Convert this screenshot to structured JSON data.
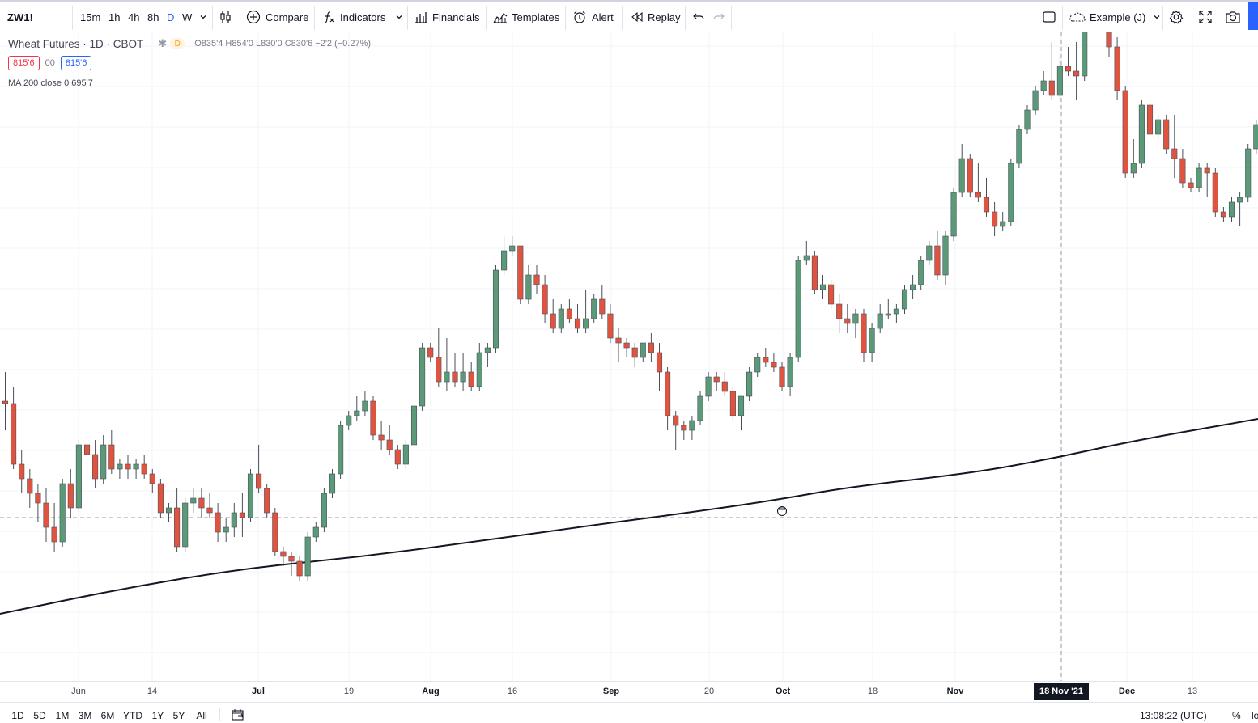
{
  "toolbar": {
    "symbol": "ZW1!",
    "timeframes": [
      "15m",
      "1h",
      "4h",
      "8h",
      "D",
      "W"
    ],
    "active_timeframe": "D",
    "compare_label": "Compare",
    "indicators_label": "Indicators",
    "financials_label": "Financials",
    "templates_label": "Templates",
    "alert_label": "Alert",
    "replay_label": "Replay",
    "layout_label": "Example (J)"
  },
  "legend": {
    "title": "Wheat Futures · 1D · CBOT",
    "status": "D",
    "ohlc": "O835'4  H854'0  L830'0  C830'6  −2'2 (−0.27%)",
    "bid": "815'6",
    "spread": "00",
    "ask": "815'6",
    "ma": "MA 200 close 0  695'7"
  },
  "colors": {
    "up": "#5b9a78",
    "down": "#e0543f",
    "ma_line": "#131722",
    "accent": "#2962ff"
  },
  "chart_data": {
    "type": "candlestick",
    "symbol": "Wheat Futures",
    "interval": "1D",
    "exchange": "CBOT",
    "x_tick_labels": [
      "Jun",
      "14",
      "Jul",
      "19",
      "Aug",
      "16",
      "Sep",
      "20",
      "Oct",
      "18",
      "Nov",
      "18 Nov '21",
      "Dec",
      "13"
    ],
    "crosshair_label": "18 Nov '21",
    "candles_ohlc_rel": [
      [
        0.44,
        0.5,
        0.38,
        0.435
      ],
      [
        0.435,
        0.47,
        0.3,
        0.31
      ],
      [
        0.31,
        0.34,
        0.25,
        0.28
      ],
      [
        0.28,
        0.3,
        0.22,
        0.25
      ],
      [
        0.25,
        0.27,
        0.19,
        0.23
      ],
      [
        0.23,
        0.26,
        0.15,
        0.18
      ],
      [
        0.18,
        0.23,
        0.13,
        0.15
      ],
      [
        0.15,
        0.28,
        0.14,
        0.27
      ],
      [
        0.27,
        0.3,
        0.2,
        0.22
      ],
      [
        0.22,
        0.36,
        0.21,
        0.35
      ],
      [
        0.35,
        0.38,
        0.3,
        0.33
      ],
      [
        0.33,
        0.36,
        0.26,
        0.28
      ],
      [
        0.28,
        0.37,
        0.27,
        0.35
      ],
      [
        0.35,
        0.38,
        0.29,
        0.3
      ],
      [
        0.3,
        0.32,
        0.28,
        0.31
      ],
      [
        0.31,
        0.33,
        0.28,
        0.3
      ],
      [
        0.3,
        0.32,
        0.28,
        0.31
      ],
      [
        0.31,
        0.33,
        0.28,
        0.29
      ],
      [
        0.29,
        0.3,
        0.25,
        0.27
      ],
      [
        0.27,
        0.28,
        0.2,
        0.21
      ],
      [
        0.21,
        0.23,
        0.19,
        0.22
      ],
      [
        0.22,
        0.26,
        0.13,
        0.14
      ],
      [
        0.14,
        0.24,
        0.13,
        0.23
      ],
      [
        0.23,
        0.26,
        0.21,
        0.24
      ],
      [
        0.24,
        0.26,
        0.2,
        0.22
      ],
      [
        0.22,
        0.25,
        0.2,
        0.21
      ],
      [
        0.21,
        0.23,
        0.15,
        0.17
      ],
      [
        0.17,
        0.2,
        0.15,
        0.18
      ],
      [
        0.18,
        0.23,
        0.16,
        0.21
      ],
      [
        0.21,
        0.25,
        0.16,
        0.2
      ],
      [
        0.2,
        0.3,
        0.19,
        0.29
      ],
      [
        0.29,
        0.35,
        0.25,
        0.26
      ],
      [
        0.26,
        0.27,
        0.2,
        0.21
      ],
      [
        0.21,
        0.22,
        0.12,
        0.13
      ],
      [
        0.13,
        0.14,
        0.1,
        0.12
      ],
      [
        0.12,
        0.13,
        0.08,
        0.11
      ],
      [
        0.11,
        0.12,
        0.07,
        0.08
      ],
      [
        0.08,
        0.17,
        0.07,
        0.16
      ],
      [
        0.16,
        0.19,
        0.15,
        0.18
      ],
      [
        0.18,
        0.26,
        0.17,
        0.25
      ],
      [
        0.25,
        0.3,
        0.24,
        0.29
      ],
      [
        0.29,
        0.4,
        0.28,
        0.39
      ],
      [
        0.39,
        0.42,
        0.38,
        0.41
      ],
      [
        0.41,
        0.45,
        0.4,
        0.42
      ],
      [
        0.42,
        0.46,
        0.41,
        0.44
      ],
      [
        0.44,
        0.45,
        0.36,
        0.37
      ],
      [
        0.37,
        0.4,
        0.34,
        0.36
      ],
      [
        0.36,
        0.39,
        0.33,
        0.34
      ],
      [
        0.34,
        0.35,
        0.3,
        0.31
      ],
      [
        0.31,
        0.36,
        0.3,
        0.35
      ],
      [
        0.35,
        0.44,
        0.34,
        0.43
      ],
      [
        0.43,
        0.56,
        0.42,
        0.55
      ],
      [
        0.55,
        0.56,
        0.52,
        0.53
      ],
      [
        0.53,
        0.59,
        0.47,
        0.48
      ],
      [
        0.48,
        0.57,
        0.46,
        0.5
      ],
      [
        0.5,
        0.54,
        0.47,
        0.48
      ],
      [
        0.48,
        0.54,
        0.46,
        0.5
      ],
      [
        0.5,
        0.52,
        0.46,
        0.47
      ],
      [
        0.47,
        0.56,
        0.46,
        0.54
      ],
      [
        0.54,
        0.56,
        0.51,
        0.55
      ],
      [
        0.55,
        0.72,
        0.54,
        0.71
      ],
      [
        0.71,
        0.78,
        0.7,
        0.75
      ],
      [
        0.75,
        0.78,
        0.74,
        0.76
      ],
      [
        0.76,
        0.76,
        0.64,
        0.65
      ],
      [
        0.65,
        0.72,
        0.64,
        0.7
      ],
      [
        0.7,
        0.72,
        0.66,
        0.68
      ],
      [
        0.68,
        0.7,
        0.6,
        0.62
      ],
      [
        0.62,
        0.65,
        0.58,
        0.59
      ],
      [
        0.59,
        0.64,
        0.58,
        0.63
      ],
      [
        0.63,
        0.65,
        0.6,
        0.61
      ],
      [
        0.61,
        0.64,
        0.58,
        0.59
      ],
      [
        0.59,
        0.67,
        0.58,
        0.61
      ],
      [
        0.61,
        0.66,
        0.6,
        0.65
      ],
      [
        0.65,
        0.68,
        0.61,
        0.62
      ],
      [
        0.62,
        0.64,
        0.56,
        0.57
      ],
      [
        0.57,
        0.59,
        0.52,
        0.56
      ],
      [
        0.56,
        0.57,
        0.53,
        0.55
      ],
      [
        0.55,
        0.56,
        0.51,
        0.53
      ],
      [
        0.53,
        0.56,
        0.52,
        0.56
      ],
      [
        0.56,
        0.58,
        0.52,
        0.54
      ],
      [
        0.54,
        0.56,
        0.46,
        0.5
      ],
      [
        0.5,
        0.51,
        0.38,
        0.41
      ],
      [
        0.41,
        0.42,
        0.34,
        0.39
      ],
      [
        0.39,
        0.4,
        0.36,
        0.38
      ],
      [
        0.38,
        0.41,
        0.36,
        0.4
      ],
      [
        0.4,
        0.46,
        0.39,
        0.45
      ],
      [
        0.45,
        0.5,
        0.44,
        0.49
      ],
      [
        0.49,
        0.5,
        0.46,
        0.48
      ],
      [
        0.48,
        0.5,
        0.45,
        0.46
      ],
      [
        0.46,
        0.47,
        0.4,
        0.41
      ],
      [
        0.41,
        0.45,
        0.38,
        0.45
      ],
      [
        0.45,
        0.51,
        0.44,
        0.5
      ],
      [
        0.5,
        0.54,
        0.49,
        0.53
      ],
      [
        0.53,
        0.55,
        0.51,
        0.52
      ],
      [
        0.52,
        0.54,
        0.5,
        0.51
      ],
      [
        0.51,
        0.52,
        0.46,
        0.47
      ],
      [
        0.47,
        0.54,
        0.45,
        0.53
      ],
      [
        0.53,
        0.74,
        0.52,
        0.73
      ],
      [
        0.73,
        0.77,
        0.72,
        0.74
      ],
      [
        0.74,
        0.75,
        0.66,
        0.67
      ],
      [
        0.67,
        0.7,
        0.65,
        0.68
      ],
      [
        0.68,
        0.69,
        0.63,
        0.64
      ],
      [
        0.64,
        0.66,
        0.58,
        0.61
      ],
      [
        0.61,
        0.64,
        0.58,
        0.6
      ],
      [
        0.6,
        0.63,
        0.57,
        0.62
      ],
      [
        0.62,
        0.63,
        0.52,
        0.54
      ],
      [
        0.54,
        0.6,
        0.52,
        0.59
      ],
      [
        0.59,
        0.64,
        0.58,
        0.62
      ],
      [
        0.62,
        0.65,
        0.61,
        0.62
      ],
      [
        0.62,
        0.64,
        0.6,
        0.63
      ],
      [
        0.63,
        0.68,
        0.62,
        0.67
      ],
      [
        0.67,
        0.7,
        0.65,
        0.68
      ],
      [
        0.68,
        0.74,
        0.67,
        0.73
      ],
      [
        0.73,
        0.77,
        0.72,
        0.76
      ],
      [
        0.76,
        0.79,
        0.69,
        0.7
      ],
      [
        0.7,
        0.79,
        0.68,
        0.78
      ],
      [
        0.78,
        0.88,
        0.77,
        0.87
      ],
      [
        0.87,
        0.97,
        0.86,
        0.94
      ],
      [
        0.94,
        0.95,
        0.86,
        0.87
      ],
      [
        0.87,
        0.93,
        0.85,
        0.86
      ],
      [
        0.86,
        0.9,
        0.82,
        0.83
      ],
      [
        0.83,
        0.85,
        0.78,
        0.8
      ],
      [
        0.8,
        0.83,
        0.79,
        0.81
      ],
      [
        0.81,
        0.94,
        0.8,
        0.93
      ],
      [
        0.93,
        1.01,
        0.92,
        1.0
      ],
      [
        1.0,
        1.05,
        0.99,
        1.04
      ],
      [
        1.04,
        1.09,
        1.03,
        1.08
      ],
      [
        1.08,
        1.12,
        1.07,
        1.1
      ],
      [
        1.1,
        1.18,
        1.06,
        1.07
      ],
      [
        1.07,
        1.15,
        1.06,
        1.13
      ],
      [
        1.13,
        1.17,
        1.11,
        1.12
      ],
      [
        1.12,
        1.18,
        1.06,
        1.11
      ],
      [
        1.11,
        1.24,
        1.1,
        1.23
      ],
      [
        1.23,
        1.28,
        1.2,
        1.27
      ],
      [
        1.27,
        1.31,
        1.22,
        1.23
      ],
      [
        1.23,
        1.26,
        1.15,
        1.17
      ],
      [
        1.17,
        1.19,
        1.06,
        1.08
      ],
      [
        1.08,
        1.09,
        0.9,
        0.91
      ],
      [
        0.91,
        0.98,
        0.9,
        0.93
      ],
      [
        0.93,
        1.06,
        0.92,
        1.05
      ],
      [
        1.05,
        1.06,
        0.98,
        0.99
      ],
      [
        0.99,
        1.03,
        0.98,
        1.02
      ],
      [
        1.02,
        1.03,
        0.95,
        0.96
      ],
      [
        0.96,
        1.03,
        0.9,
        0.94
      ],
      [
        0.94,
        0.96,
        0.88,
        0.89
      ],
      [
        0.89,
        0.9,
        0.87,
        0.88
      ],
      [
        0.88,
        0.93,
        0.87,
        0.92
      ],
      [
        0.92,
        0.93,
        0.86,
        0.91
      ],
      [
        0.91,
        0.92,
        0.82,
        0.83
      ],
      [
        0.83,
        0.84,
        0.81,
        0.82
      ],
      [
        0.82,
        0.86,
        0.81,
        0.85
      ],
      [
        0.85,
        0.87,
        0.8,
        0.86
      ],
      [
        0.86,
        0.97,
        0.85,
        0.96
      ],
      [
        0.96,
        1.02,
        0.95,
        1.01
      ]
    ],
    "ma_200": {
      "name": "MA 200 close 0",
      "last_value": "695'7"
    }
  },
  "time_axis": {
    "ticks": [
      "Jun",
      "14",
      "Jul",
      "19",
      "Aug",
      "16",
      "Sep",
      "20",
      "Oct",
      "18",
      "Nov",
      "18 Nov '21",
      "Dec",
      "13"
    ]
  },
  "bottom_bar": {
    "ranges": [
      "1D",
      "5D",
      "1M",
      "3M",
      "6M",
      "YTD",
      "1Y",
      "5Y",
      "All"
    ],
    "clock": "13:08:22 (UTC)",
    "percent": "%",
    "log": "lo"
  }
}
